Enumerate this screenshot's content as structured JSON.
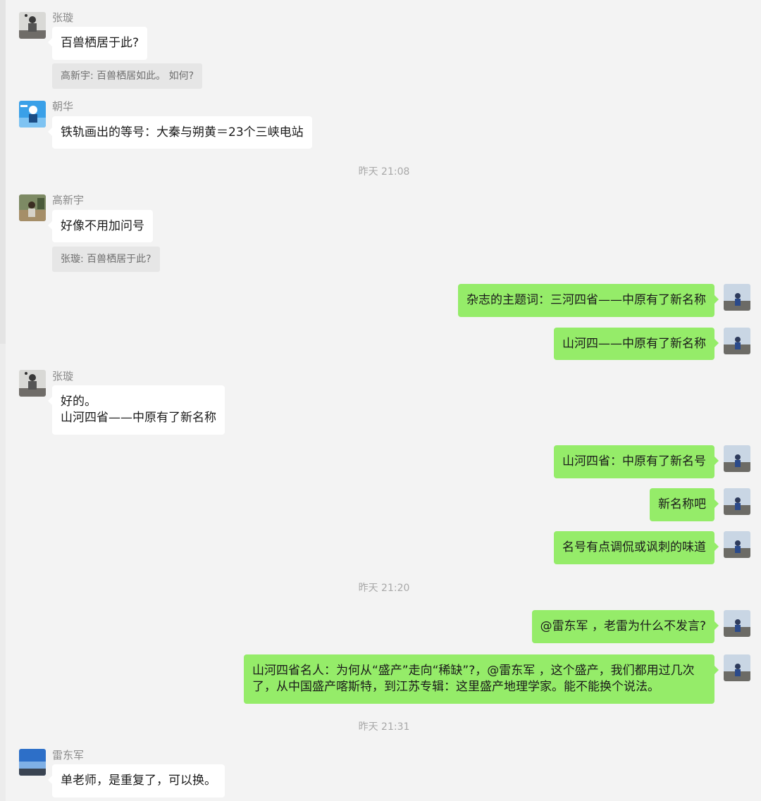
{
  "messages": [
    {
      "sender": "张璇",
      "text": "百兽栖居于此?",
      "quote": "高新宇: 百兽栖居如此。 如何?"
    },
    {
      "sender": "朝华",
      "text": "铁轨画出的等号：大秦与朔黄＝23个三峡电站"
    },
    {
      "time": "昨天 21:08"
    },
    {
      "sender": "高新宇",
      "text": "好像不用加问号",
      "quote": "张璇: 百兽栖居于此?"
    },
    {
      "self": true,
      "text": "杂志的主题词：三河四省——中原有了新名称"
    },
    {
      "self": true,
      "text": "山河四——中原有了新名称"
    },
    {
      "sender": "张璇",
      "text": "好的。\n山河四省——中原有了新名称"
    },
    {
      "self": true,
      "text": "山河四省：中原有了新名号"
    },
    {
      "self": true,
      "text": "新名称吧"
    },
    {
      "self": true,
      "text": "名号有点调侃或讽刺的味道"
    },
    {
      "time": "昨天 21:20"
    },
    {
      "self": true,
      "text": "@雷东军 ，老雷为什么不发言?"
    },
    {
      "self": true,
      "text": "山河四省名人：为何从“盛产”走向“稀缺”?，@雷东军 ，这个盛产，我们都用过几次\n了，从中国盛产喀斯特，到江苏专辑：这里盛产地理学家。能不能换个说法。"
    },
    {
      "time": "昨天 21:31"
    },
    {
      "sender": "雷东军",
      "text": "单老师，是重复了，可以换。"
    }
  ],
  "colors": {
    "self_bubble": "#95ec69",
    "other_bubble": "#ffffff",
    "background": "#f3f3f3"
  }
}
